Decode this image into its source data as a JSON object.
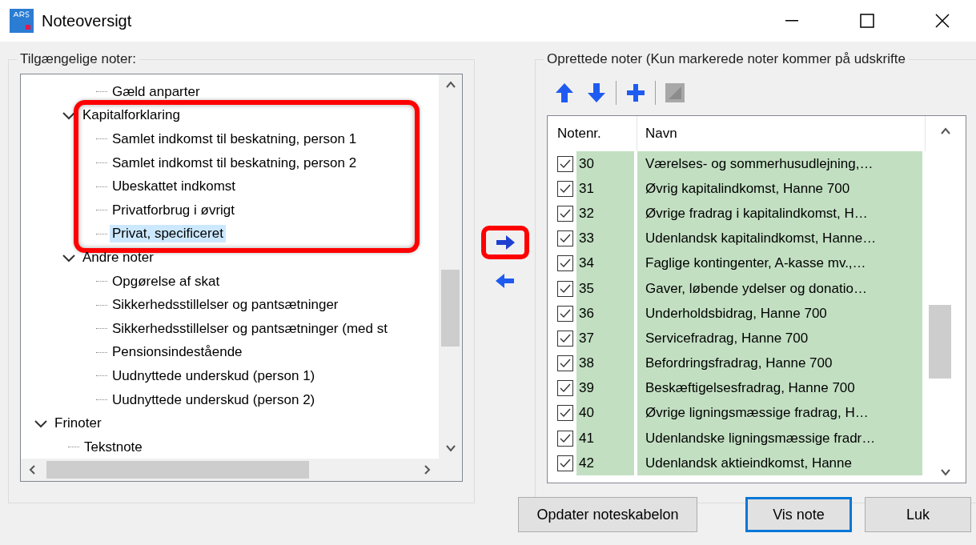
{
  "window": {
    "title": "Noteoversigt"
  },
  "available": {
    "title": "Tilgængelige noter:",
    "tree": [
      {
        "children": [
          {
            "children": [
              {
                "label": "Gæld anparter",
                "selected": false
              }
            ]
          },
          {
            "label": "Kapitalforklaring",
            "selected": false,
            "expanded": true,
            "highlighted": true,
            "children": [
              {
                "label": "Samlet indkomst til beskatning, person 1",
                "selected": false
              },
              {
                "label": "Samlet indkomst til beskatning, person 2",
                "selected": false
              },
              {
                "label": "Ubeskattet indkomst",
                "selected": false
              },
              {
                "label": "Privatforbrug i øvrigt",
                "selected": false
              },
              {
                "label": "Privat, specificeret",
                "selected": true
              }
            ]
          },
          {
            "label": "Andre noter",
            "selected": false,
            "expanded": true,
            "highlighted": false,
            "children": [
              {
                "label": "Opgørelse af skat",
                "selected": false
              },
              {
                "label": "Sikkerhedsstillelser og pantsætninger",
                "selected": false
              },
              {
                "label": "Sikkerhedsstillelser og pantsætninger (med st",
                "selected": false
              },
              {
                "label": "Pensionsindestående",
                "selected": false
              },
              {
                "label": "Uudnyttede underskud (person 1)",
                "selected": false
              },
              {
                "label": "Uudnyttede underskud (person 2)",
                "selected": false
              }
            ]
          }
        ]
      },
      {
        "label": "Frinoter",
        "selected": false,
        "expanded": true,
        "highlighted": false,
        "children": [
          {
            "label": "Tekstnote",
            "selected": false
          }
        ]
      }
    ]
  },
  "transfer": [
    {
      "kind": "add",
      "highlighted": true
    },
    {
      "kind": "remove",
      "highlighted": false
    }
  ],
  "created": {
    "title": "Oprettede noter (Kun markerede noter kommer på udskrifte",
    "toolbar": [
      {
        "kind": "up",
        "disabled": false
      },
      {
        "kind": "down",
        "disabled": false
      },
      {
        "kind": "separator"
      },
      {
        "kind": "add",
        "disabled": false
      },
      {
        "kind": "separator"
      },
      {
        "kind": "edit",
        "disabled": true
      }
    ],
    "columns": [
      "Notenr.",
      "Navn"
    ],
    "rows": [
      {
        "checked": true,
        "number": "30",
        "name": "Værelses- og sommerhusudlejning,…"
      },
      {
        "checked": true,
        "number": "31",
        "name": "Øvrig kapitalindkomst, Hanne 700"
      },
      {
        "checked": true,
        "number": "32",
        "name": "Øvrige fradrag i kapitalindkomst, H…"
      },
      {
        "checked": true,
        "number": "33",
        "name": "Udenlandsk kapitalindkomst, Hanne…"
      },
      {
        "checked": true,
        "number": "34",
        "name": "Faglige kontingenter, A-kasse mv.,…"
      },
      {
        "checked": true,
        "number": "35",
        "name": "Gaver, løbende ydelser og donatio…"
      },
      {
        "checked": true,
        "number": "36",
        "name": "Underholdsbidrag, Hanne 700"
      },
      {
        "checked": true,
        "number": "37",
        "name": "Servicefradrag, Hanne 700"
      },
      {
        "checked": true,
        "number": "38",
        "name": "Befordringsfradrag, Hanne 700"
      },
      {
        "checked": true,
        "number": "39",
        "name": "Beskæftigelsesfradrag, Hanne 700"
      },
      {
        "checked": true,
        "number": "40",
        "name": "Øvrige ligningsmæssige fradrag, H…"
      },
      {
        "checked": true,
        "number": "41",
        "name": "Udenlandske ligningsmæssige fradr…"
      },
      {
        "checked": true,
        "number": "42",
        "name": "Udenlandsk aktieindkomst, Hanne"
      }
    ]
  },
  "buttons": [
    {
      "label": "Opdater noteskabelon",
      "default": false
    },
    {
      "label": "Vis note",
      "default": true
    },
    {
      "label": "Luk",
      "default": false
    }
  ]
}
